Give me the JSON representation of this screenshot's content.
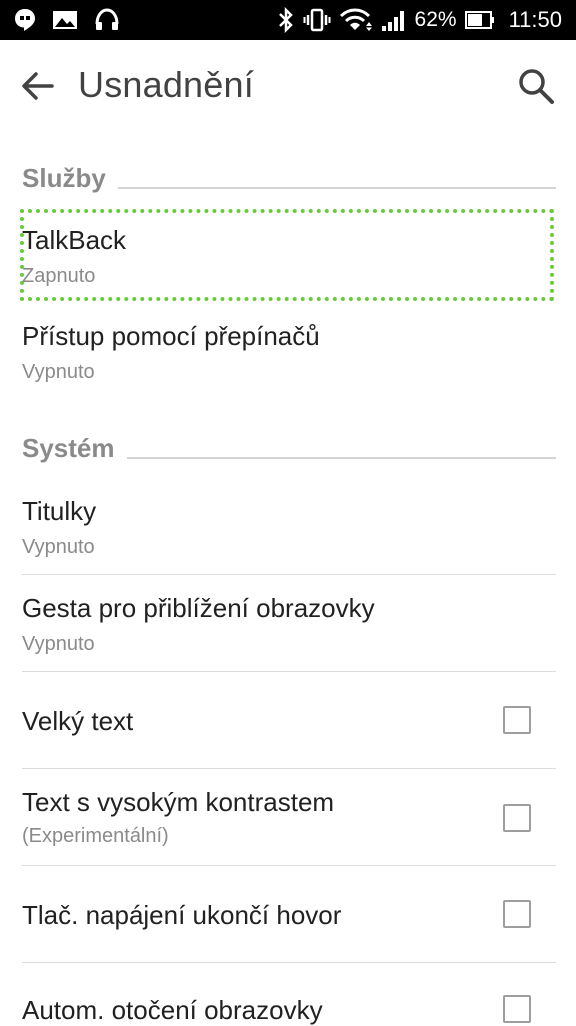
{
  "status_bar": {
    "battery_percent": "62%",
    "time": "11:50",
    "icons": [
      "hangouts-icon",
      "image-icon",
      "headset-icon",
      "bluetooth-icon",
      "vibrate-icon",
      "wifi-icon",
      "signal-icon",
      "battery-icon"
    ]
  },
  "app_bar": {
    "title": "Usnadnění"
  },
  "sections": {
    "services": {
      "title": "Služby"
    },
    "system": {
      "title": "Systém"
    }
  },
  "items": {
    "talkback": {
      "title": "TalkBack",
      "subtitle": "Zapnuto"
    },
    "switch_access": {
      "title": "Přístup pomocí přepínačů",
      "subtitle": "Vypnuto"
    },
    "captions": {
      "title": "Titulky",
      "subtitle": "Vypnuto"
    },
    "magnification": {
      "title": "Gesta pro přiblížení obrazovky",
      "subtitle": "Vypnuto"
    },
    "large_text": {
      "title": "Velký text",
      "checked": false
    },
    "high_contrast": {
      "title": "Text s vysokým kontrastem",
      "subtitle": "(Experimentální)",
      "checked": false
    },
    "power_ends_call": {
      "title": "Tlač. napájení ukončí hovor",
      "checked": false
    },
    "auto_rotate": {
      "title": "Autom. otočení obrazovky",
      "checked": false
    }
  },
  "colors": {
    "focus_outline": "#6dc93c",
    "status_bar_bg": "#000000",
    "section_title": "#8a8a8a"
  }
}
